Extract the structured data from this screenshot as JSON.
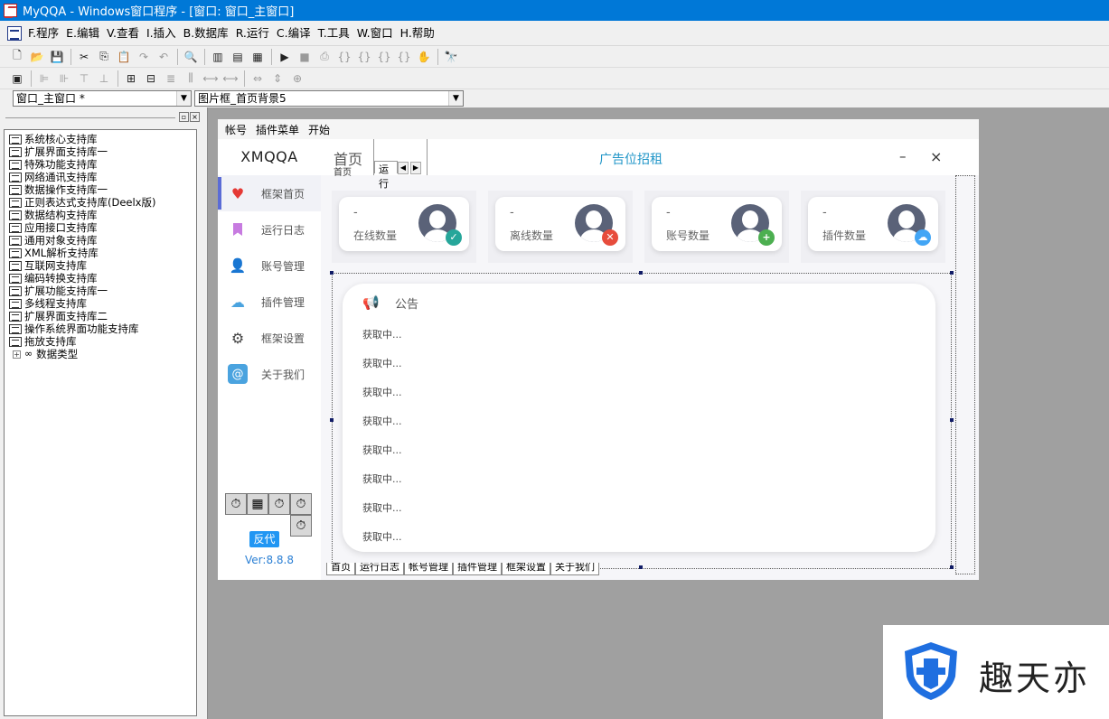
{
  "window": {
    "title": "MyQQA - Windows窗口程序 - [窗口: 窗口_主窗口]"
  },
  "menu": [
    {
      "label": "F.程序"
    },
    {
      "label": "E.编辑"
    },
    {
      "label": "V.查看"
    },
    {
      "label": "I.插入"
    },
    {
      "label": "B.数据库"
    },
    {
      "label": "R.运行"
    },
    {
      "label": "C.编译"
    },
    {
      "label": "T.工具"
    },
    {
      "label": "W.窗口"
    },
    {
      "label": "H.帮助"
    }
  ],
  "combos": {
    "window_select": "窗口_主窗口 *",
    "component_select": "图片框_首页背景5"
  },
  "library_tree": [
    "系统核心支持库",
    "扩展界面支持库一",
    "特殊功能支持库",
    "网络通讯支持库",
    "数据操作支持库一",
    "正则表达式支持库(Deelx版)",
    "数据结构支持库",
    "应用接口支持库",
    "通用对象支持库",
    "XML解析支持库",
    "互联网支持库",
    "编码转换支持库",
    "扩展功能支持库一",
    "多线程支持库",
    "扩展界面支持库二",
    "操作系统界面功能支持库",
    "拖放支持库"
  ],
  "tree_extra": "数据类型",
  "form": {
    "menubar": [
      "帐号",
      "插件菜单",
      "开始"
    ],
    "brand": "XMQQA",
    "nav": [
      {
        "label": "框架首页",
        "icon": "heart-icon"
      },
      {
        "label": "运行日志",
        "icon": "bookmark-icon"
      },
      {
        "label": "账号管理",
        "icon": "user-icon"
      },
      {
        "label": "插件管理",
        "icon": "cloud-icon"
      },
      {
        "label": "框架设置",
        "icon": "gear-icon"
      },
      {
        "label": "关于我们",
        "icon": "at-icon"
      }
    ],
    "fanDai": "反代",
    "version": "Ver:8.8.8",
    "header": {
      "tab_title": "首页",
      "tab_sub": "首页",
      "mini_tab": "运行",
      "center_title": "广告位招租",
      "minimize": "–",
      "close": "×"
    },
    "stats": [
      {
        "value": "-",
        "label": "在线数量",
        "badge": "✓",
        "badge_color": "#26a69a"
      },
      {
        "value": "-",
        "label": "离线数量",
        "badge": "✕",
        "badge_color": "#e74c3c"
      },
      {
        "value": "-",
        "label": "账号数量",
        "badge": "+",
        "badge_color": "#4caf50"
      },
      {
        "value": "-",
        "label": "插件数量",
        "badge": "☁",
        "badge_color": "#42a5f5"
      }
    ],
    "notice": {
      "title": "公告",
      "lines": [
        "获取中...",
        "获取中...",
        "获取中...",
        "获取中...",
        "获取中...",
        "获取中...",
        "获取中...",
        "获取中..."
      ]
    },
    "bottom_tabs": [
      "首页",
      "运行日志",
      "帐号管理",
      "插件管理",
      "框架设置",
      "关于我们"
    ]
  },
  "watermark": "趣天亦",
  "colors": {
    "titlebar": "#0078d7",
    "accent": "#5b6cd6",
    "header_title": "#2196c8",
    "fandai": "#2196f3"
  }
}
